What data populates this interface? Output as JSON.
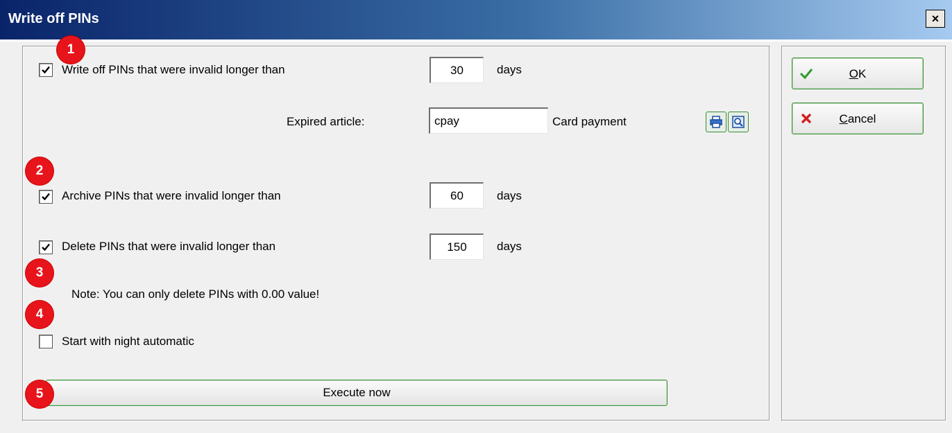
{
  "window": {
    "title": "Write off PINs",
    "close_label": "×"
  },
  "rows": {
    "write_off": {
      "label": "Write off PINs that were invalid longer than",
      "value": "30",
      "unit": "days",
      "checked": true
    },
    "expired": {
      "label": "Expired article:",
      "value": "cpay",
      "description": "Card payment"
    },
    "archive": {
      "label": "Archive PINs that were invalid longer than",
      "value": "60",
      "unit": "days",
      "checked": true
    },
    "delete": {
      "label": "Delete PINs that were invalid longer than",
      "value": "150",
      "unit": "days",
      "checked": true
    },
    "note": "Note: You can only delete PINs with 0.00 value!",
    "night": {
      "label": "Start with night automatic",
      "checked": false
    }
  },
  "buttons": {
    "execute": "Execute now",
    "ok": "OK",
    "cancel": "Cancel"
  },
  "badges": [
    "1",
    "2",
    "3",
    "4",
    "5"
  ],
  "icons": {
    "print": "print-icon",
    "lookup": "lookup-icon",
    "ok": "checkmark-icon",
    "cancel": "x-icon"
  },
  "colors": {
    "badge": "#e8141b",
    "accent": "#3c8f3c",
    "title_start": "#0a246a",
    "title_end": "#a6caf0"
  }
}
